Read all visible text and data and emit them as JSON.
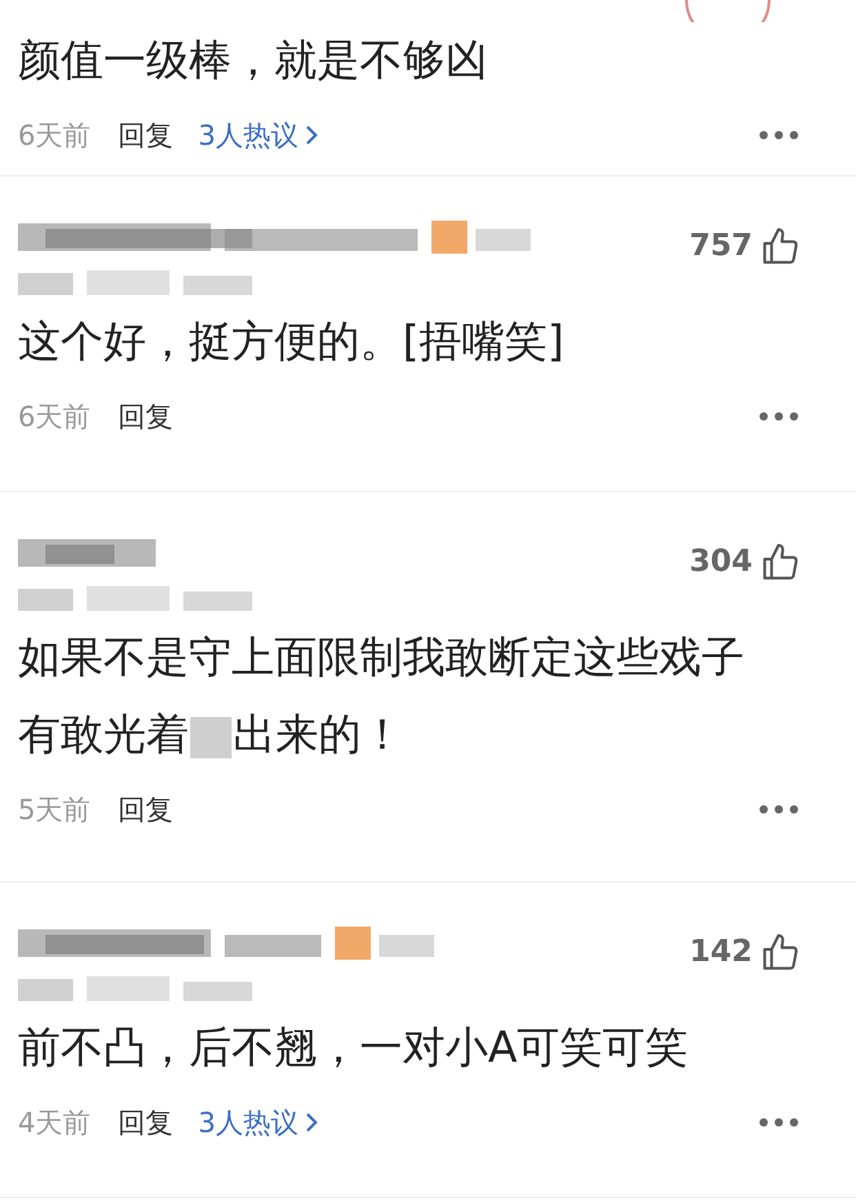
{
  "comments": [
    {
      "text": "颜值一级棒，就是不够凶",
      "time": "6天前",
      "reply": "回复",
      "discussion": "3人热议"
    },
    {
      "badge": true,
      "likes": "757",
      "text": "这个好，挺方便的。[捂嘴笑]",
      "time": "6天前",
      "reply": "回复"
    },
    {
      "badge": false,
      "likes": "304",
      "text": "如果不是守上面限制我敢断定这些戏子有敢光着",
      "censored": true,
      "text_after": "出来的！",
      "time": "5天前",
      "reply": "回复"
    },
    {
      "badge": true,
      "likes": "142",
      "text": "前不凸，后不翘，一对小A可笑可笑",
      "time": "4天前",
      "reply": "回复",
      "discussion": "3人热议"
    }
  ]
}
